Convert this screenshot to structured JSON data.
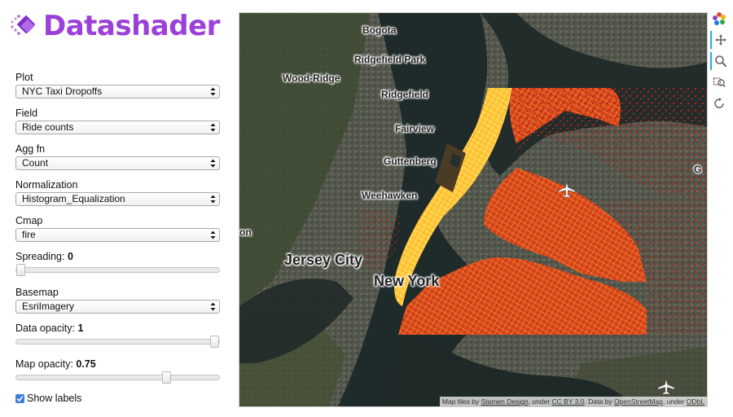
{
  "app": {
    "title": "Datashader",
    "brand_color": "#9b40d8"
  },
  "controls": {
    "plot": {
      "label": "Plot",
      "value": "NYC Taxi Dropoffs"
    },
    "field": {
      "label": "Field",
      "value": "Ride counts"
    },
    "agg_fn": {
      "label": "Agg fn",
      "value": "Count"
    },
    "normalization": {
      "label": "Normalization",
      "value": "Histogram_Equalization"
    },
    "cmap": {
      "label": "Cmap",
      "value": "fire"
    },
    "spreading": {
      "label": "Spreading:",
      "value": "0",
      "fraction": 0.0
    },
    "basemap": {
      "label": "Basemap",
      "value": "EsriImagery"
    },
    "data_opacity": {
      "label": "Data opacity:",
      "value": "1",
      "fraction": 1.0
    },
    "map_opacity": {
      "label": "Map opacity:",
      "value": "0.75",
      "fraction": 0.75
    },
    "show_labels": {
      "label": "Show labels",
      "checked": true
    }
  },
  "map": {
    "places": {
      "bogota": "Bogota",
      "ridgefield_park": "Ridgefield Park",
      "wood_ridge": "Wood-Ridge",
      "ridgefield": "Ridgefield",
      "fairview": "Fairview",
      "guttenberg": "Guttenberg",
      "weehawken": "Weehawken",
      "jersey_city": "Jersey City",
      "new_york": "New York",
      "edge_left": "on",
      "edge_right": "G"
    },
    "attribution": {
      "prefix": "Map tiles by ",
      "stamen": "Stamen Design",
      "mid1": ", under ",
      "license": "CC BY 3.0",
      "mid2": ". Data by ",
      "osm": "OpenStreetMap",
      "mid3": ", under ",
      "odbl": "ODbL"
    },
    "airport_icon": "airplane-icon"
  },
  "toolbar": {
    "tools": [
      "bokeh-logo-icon",
      "pan-icon",
      "wheel-zoom-icon",
      "box-zoom-icon",
      "reset-icon"
    ]
  }
}
